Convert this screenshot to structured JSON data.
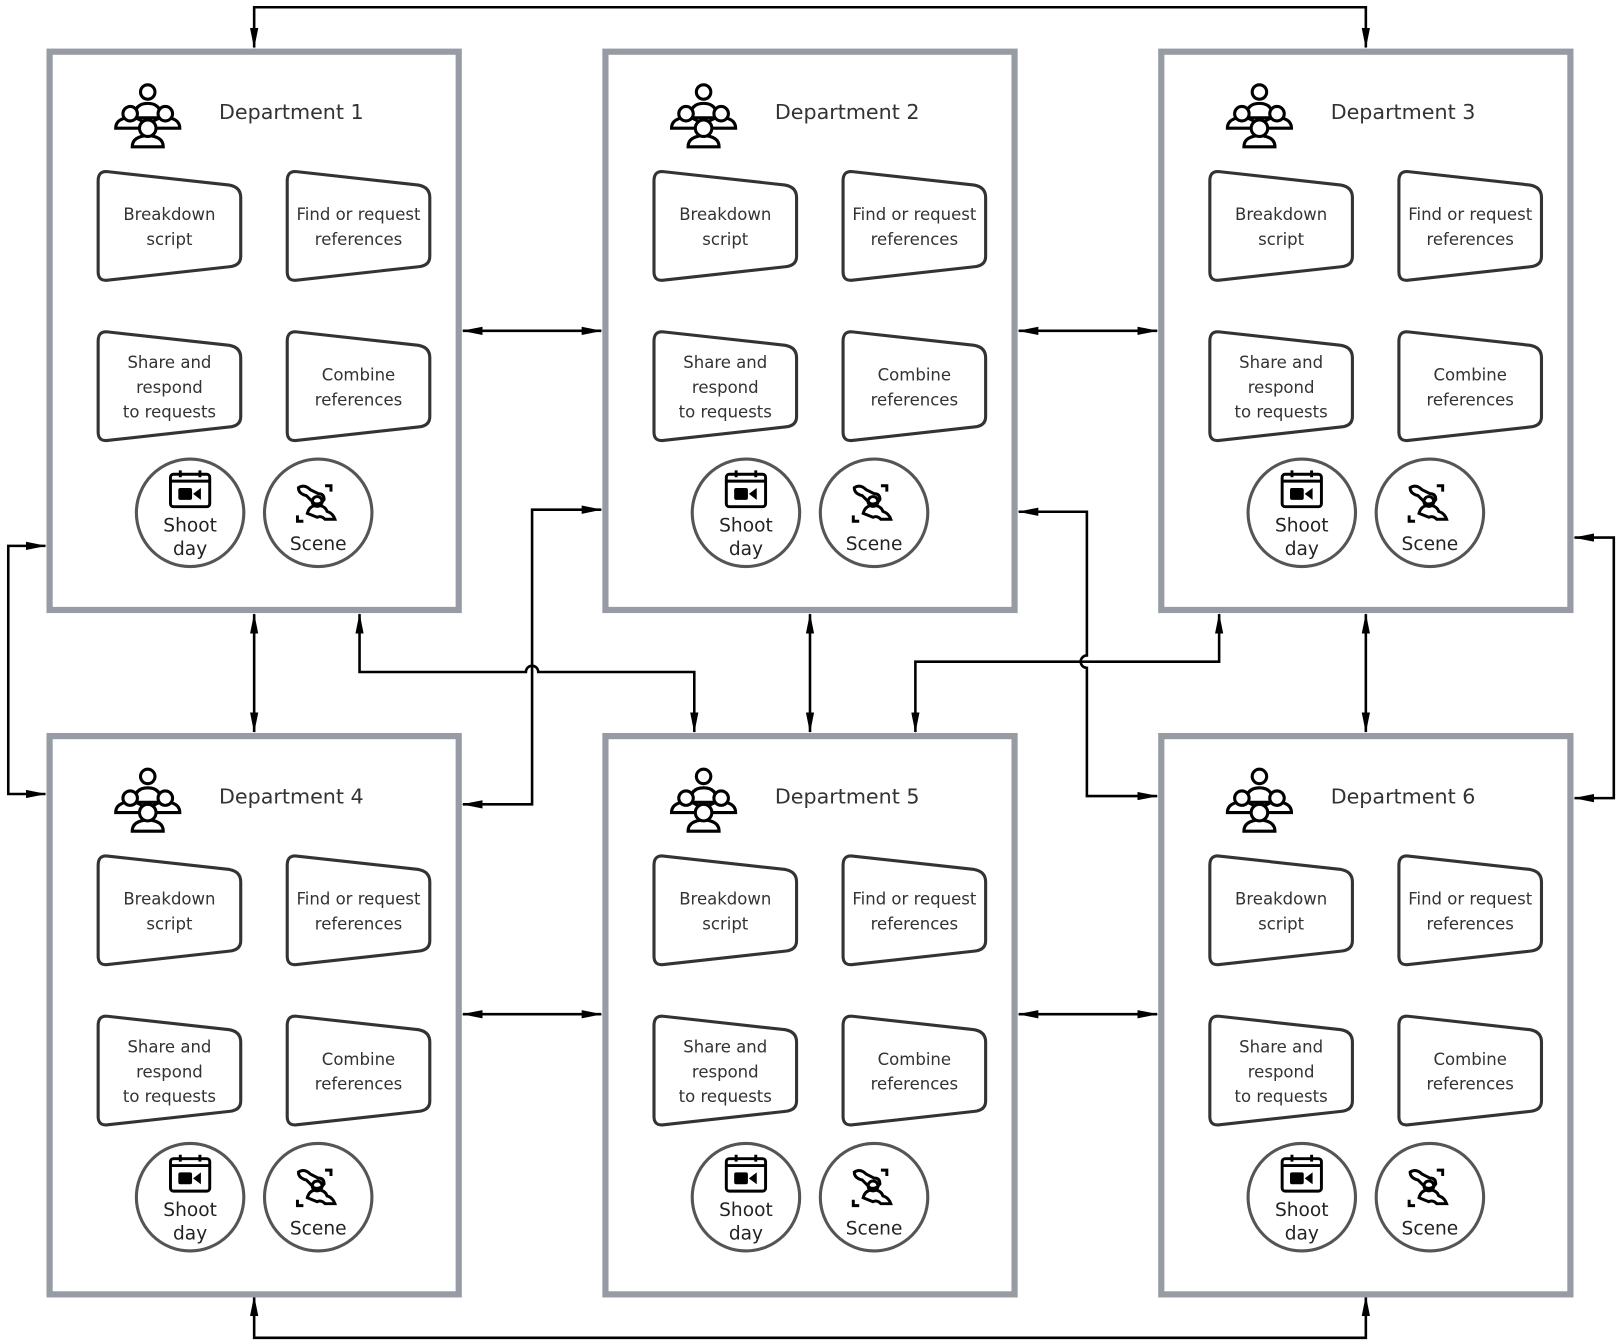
{
  "colors": {
    "box_border": "#979ca4",
    "shape_stroke": "#333333",
    "circle_stroke": "#555555",
    "arrow": "#000000"
  },
  "departments": [
    {
      "title": "Department 1"
    },
    {
      "title": "Department 2"
    },
    {
      "title": "Department 3"
    },
    {
      "title": "Department 4"
    },
    {
      "title": "Department 5"
    },
    {
      "title": "Department 6"
    }
  ],
  "department_icon": "people-group-icon",
  "tasks": [
    {
      "lines": [
        "Breakdown",
        "script"
      ]
    },
    {
      "lines": [
        "Find or request",
        "references"
      ]
    },
    {
      "lines": [
        "Share and",
        "respond",
        "to requests"
      ]
    },
    {
      "lines": [
        "Combine",
        "references"
      ]
    }
  ],
  "badges": [
    {
      "icon": "calendar-video-icon",
      "lines": [
        "Shoot",
        "day"
      ]
    },
    {
      "icon": "scene-actors-icon",
      "lines": [
        "Scene"
      ]
    }
  ],
  "connections": [
    [
      "Department 1",
      "Department 2"
    ],
    [
      "Department 2",
      "Department 3"
    ],
    [
      "Department 4",
      "Department 5"
    ],
    [
      "Department 5",
      "Department 6"
    ],
    [
      "Department 1",
      "Department 4"
    ],
    [
      "Department 2",
      "Department 5"
    ],
    [
      "Department 3",
      "Department 6"
    ],
    [
      "Department 1",
      "Department 3"
    ],
    [
      "Department 4",
      "Department 6"
    ],
    [
      "Department 1",
      "Department 5"
    ],
    [
      "Department 4",
      "Department 2"
    ],
    [
      "Department 2",
      "Department 6"
    ],
    [
      "Department 3",
      "Department 5"
    ]
  ]
}
